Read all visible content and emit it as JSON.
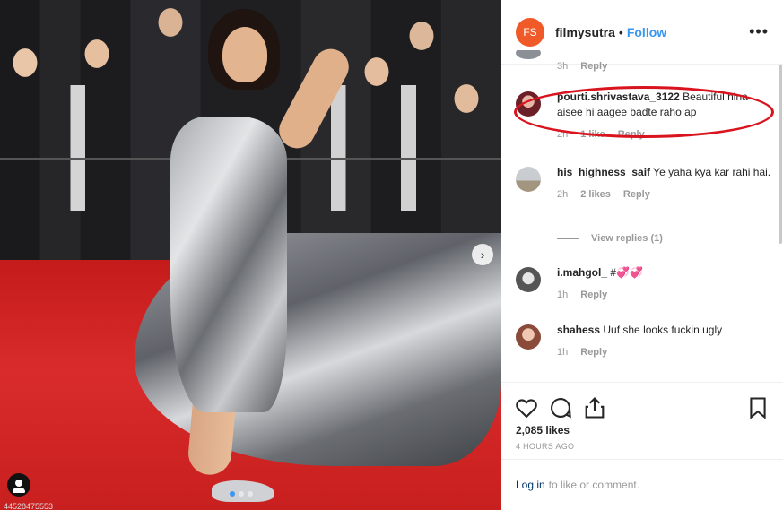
{
  "post": {
    "photo_caption_overlay": "44528475553",
    "carousel_dots": 3,
    "active_dot": 0
  },
  "header": {
    "avatar_initials": "FS",
    "username": "filmysutra",
    "separator": "•",
    "follow_label": "Follow",
    "more_label": "•••"
  },
  "comments": [
    {
      "user": "",
      "text": "",
      "time": "3h",
      "likes": "",
      "reply": "Reply"
    },
    {
      "user": "pourti.shrivastava_3122",
      "text": "Beautiful nina aisee hi aagee badte raho ap",
      "time": "2h",
      "likes": "1 like",
      "reply": "Reply"
    },
    {
      "user": "his_highness_saif",
      "text": "Ye yaha kya kar rahi hai.",
      "time": "2h",
      "likes": "2 likes",
      "reply": "Reply"
    },
    {
      "user": "i.mahgol_",
      "text": "#💞💞",
      "time": "1h",
      "likes": "",
      "reply": "Reply"
    },
    {
      "user": "shahess",
      "text": "Uuf she looks fuckin ugly",
      "time": "1h",
      "likes": "",
      "reply": "Reply"
    }
  ],
  "view_replies": "View replies (1)",
  "actions": {
    "likes": "2,085 likes",
    "time_ago": "4 HOURS AGO"
  },
  "login": {
    "link": "Log in",
    "rest": "to like or comment."
  },
  "colors": {
    "accent_blue": "#3897f0",
    "brand_orange": "#f05a28",
    "annotation_red": "#d9141e"
  }
}
